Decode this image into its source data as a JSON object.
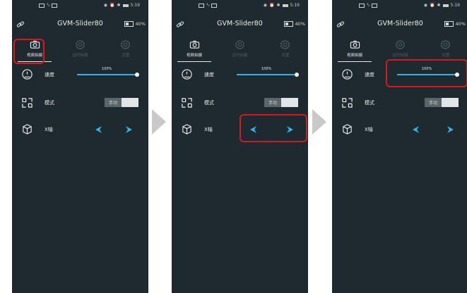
{
  "status_bar": {
    "time": "5:19"
  },
  "header": {
    "title": "GVM-Slider80",
    "battery": "40%"
  },
  "tabs": [
    {
      "label": "视频拍摄",
      "icon": "camera-icon",
      "active": true
    },
    {
      "label": "延时拍摄",
      "icon": "timer-icon",
      "active": false
    },
    {
      "label": "设置",
      "icon": "gear-icon",
      "active": false
    }
  ],
  "rows": {
    "speed": {
      "label": "速度",
      "icon": "speedometer-icon",
      "value_text": "100%",
      "value": 100
    },
    "mode": {
      "label": "模式",
      "icon": "mode-icon",
      "toggle_text": "手动"
    },
    "x_axis": {
      "label": "X轴",
      "icon": "cube-icon",
      "left": "left-arrow-icon",
      "right": "right-arrow-icon"
    }
  },
  "colors": {
    "background": "#1e2a30",
    "accent": "#2fb5e7",
    "highlight": "#d31922",
    "inactive": "#4b5b62"
  },
  "panels": [
    {
      "highlight": "tab-video"
    },
    {
      "highlight": "x-axis-arrows"
    },
    {
      "highlight": "speed-slider"
    }
  ]
}
